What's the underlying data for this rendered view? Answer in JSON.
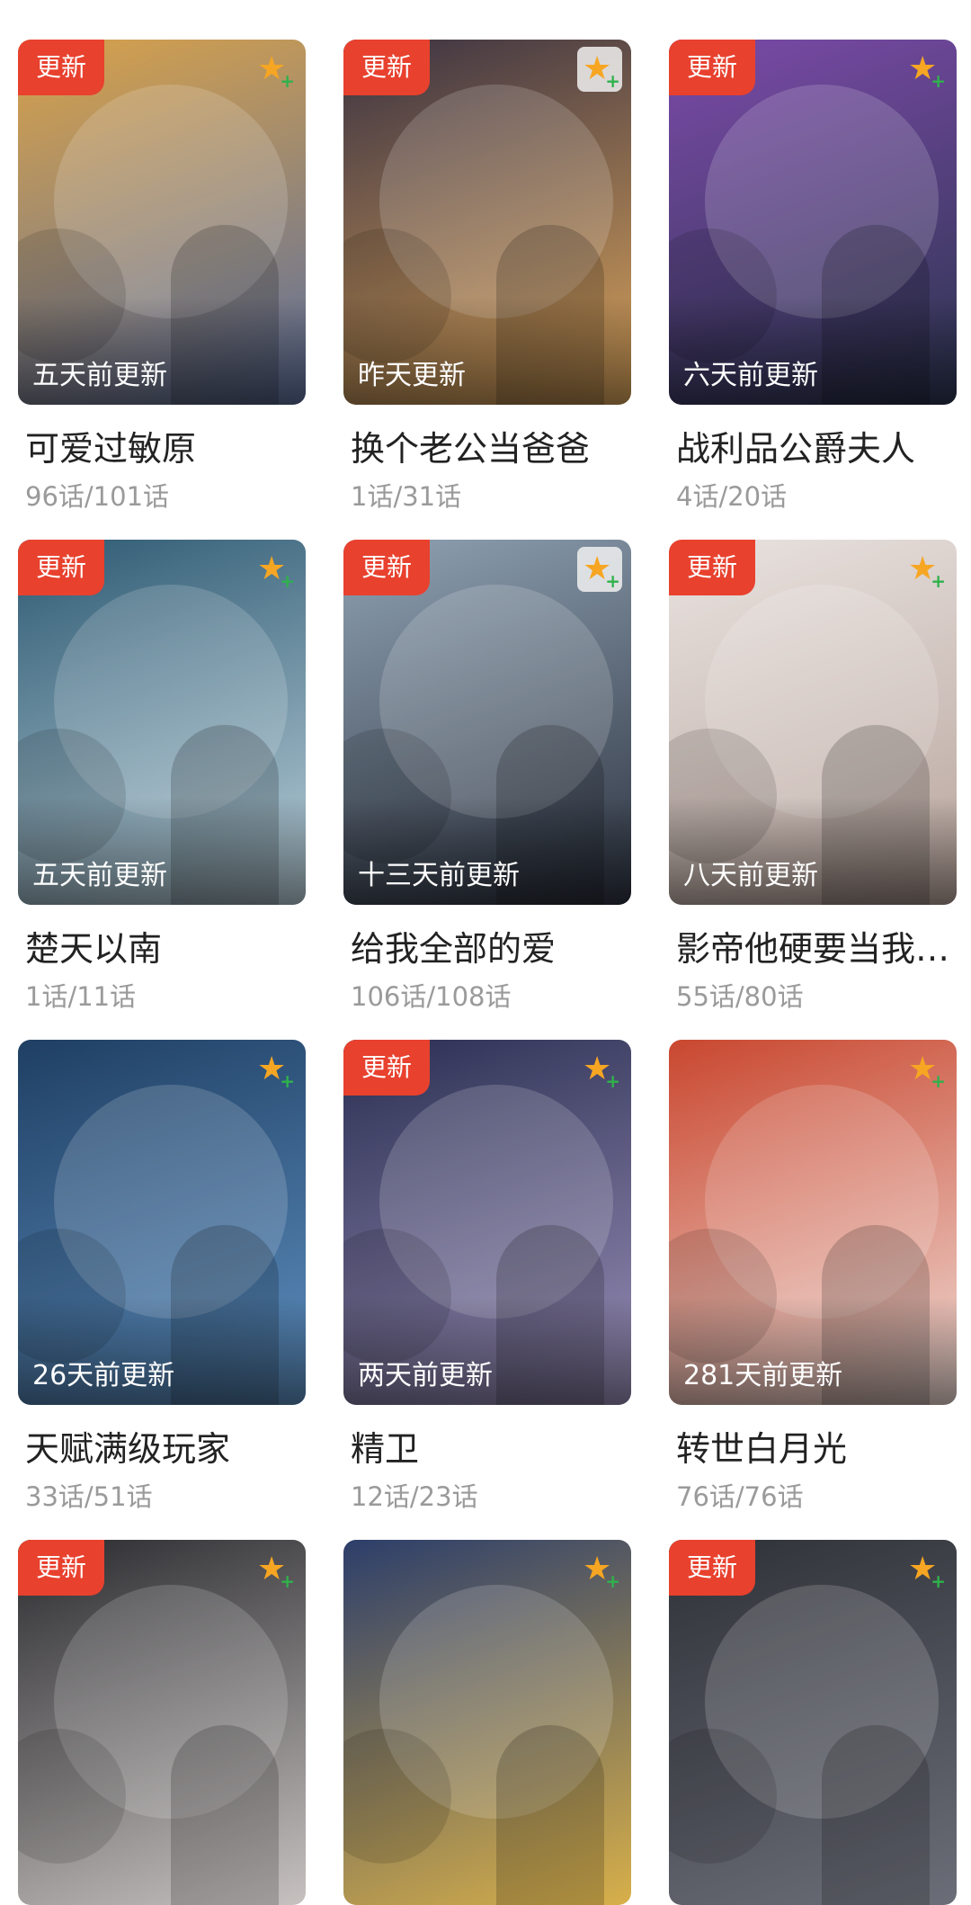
{
  "comics": [
    {
      "title": "可爱过敏原",
      "progress": "96话/101话",
      "update_time": "五天前更新",
      "badge": "更新",
      "favorite_icon": "star-plus-icon",
      "colors": [
        "#d9a24a",
        "#5c6f9c"
      ]
    },
    {
      "title": "换个老公当爸爸",
      "progress": "1话/31话",
      "update_time": "昨天更新",
      "badge": "更新",
      "favorite_icon": "star-plus-icon",
      "colors": [
        "#3b3242",
        "#d9a35a"
      ]
    },
    {
      "title": "战利品公爵夫人",
      "progress": "4话/20话",
      "update_time": "六天前更新",
      "badge": "更新",
      "favorite_icon": "star-plus-icon",
      "colors": [
        "#7b4aa8",
        "#2c3550"
      ]
    },
    {
      "title": "楚天以南",
      "progress": "1话/11话",
      "update_time": "五天前更新",
      "badge": "更新",
      "favorite_icon": "star-plus-icon",
      "colors": [
        "#2e5a73",
        "#b9cfd9"
      ]
    },
    {
      "title": "给我全部的爱",
      "progress": "106话/108话",
      "update_time": "十三天前更新",
      "badge": "更新",
      "favorite_icon": "star-plus-icon",
      "colors": [
        "#8fa2b3",
        "#2d3340"
      ]
    },
    {
      "title": "影帝他硬要当我…",
      "progress": "55话/80话",
      "update_time": "八天前更新",
      "badge": "更新",
      "favorite_icon": "star-plus-icon",
      "colors": [
        "#e9e3e0",
        "#b8a49c"
      ]
    },
    {
      "title": "天赋满级玩家",
      "progress": "33话/51话",
      "update_time": "26天前更新",
      "badge": "",
      "favorite_icon": "star-plus-icon",
      "colors": [
        "#1f3f63",
        "#5d8fc0"
      ]
    },
    {
      "title": "精卫",
      "progress": "12话/23话",
      "update_time": "两天前更新",
      "badge": "更新",
      "favorite_icon": "star-plus-icon",
      "colors": [
        "#2a2f52",
        "#9a8fb8"
      ]
    },
    {
      "title": "转世白月光",
      "progress": "76话/76话",
      "update_time": "281天前更新",
      "badge": "",
      "favorite_icon": "star-plus-icon",
      "colors": [
        "#c9472f",
        "#f0dcd6"
      ]
    },
    {
      "title": "",
      "progress": "",
      "update_time": "",
      "badge": "更新",
      "favorite_icon": "star-plus-icon",
      "colors": [
        "#2a2a2e",
        "#c7c2c0"
      ]
    },
    {
      "title": "",
      "progress": "",
      "update_time": "",
      "badge": "",
      "favorite_icon": "star-plus-icon",
      "colors": [
        "#2c3e6a",
        "#d8b04a"
      ]
    },
    {
      "title": "",
      "progress": "",
      "update_time": "",
      "badge": "更新",
      "favorite_icon": "star-plus-icon",
      "colors": [
        "#2f3138",
        "#6b6e78"
      ]
    }
  ]
}
